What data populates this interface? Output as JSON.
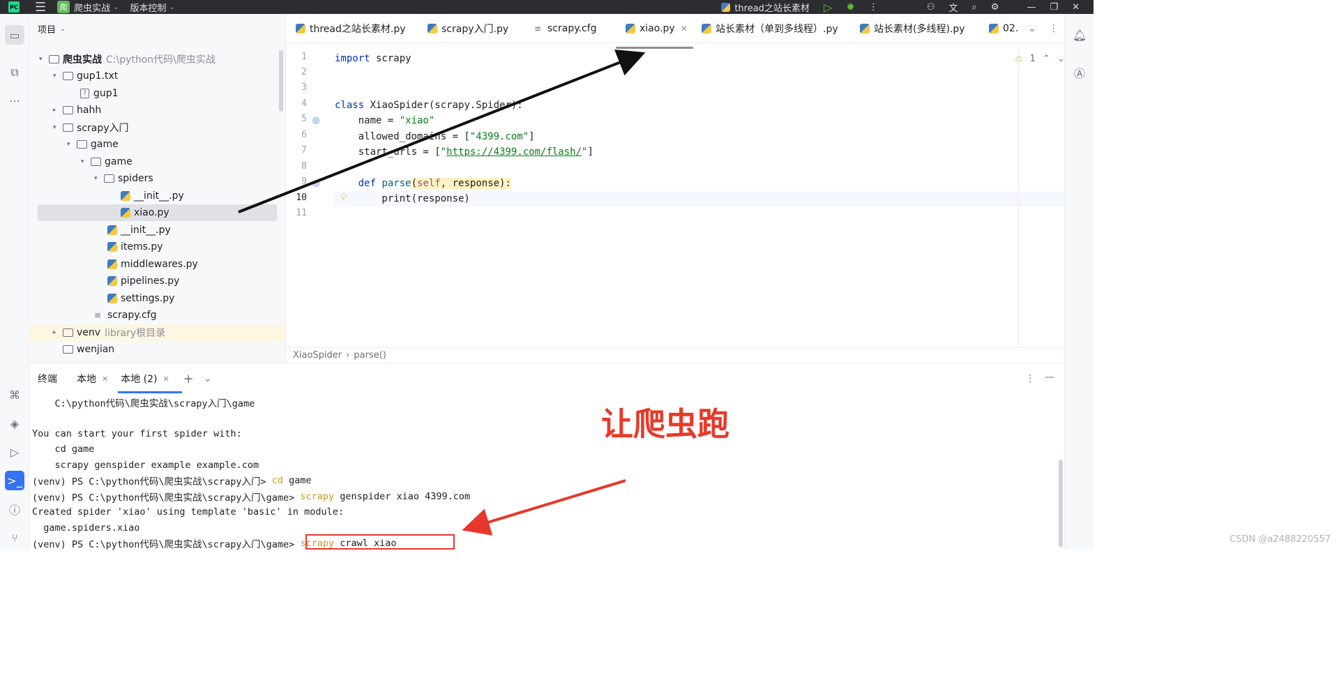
{
  "titlebar": {
    "project_badge": "爬",
    "project_name": "爬虫实战",
    "vcs": "版本控制",
    "run_config": "thread之站长素材"
  },
  "project_panel": {
    "title": "项目",
    "tree": [
      {
        "label": "爬虫实战",
        "extra": "C:\\python代码\\爬虫实战",
        "kind": "folder",
        "expanded": true
      },
      {
        "label": "gup1.txt",
        "kind": "folder",
        "expanded": true
      },
      {
        "label": "gup1",
        "kind": "txt"
      },
      {
        "label": "hahh",
        "kind": "folder",
        "expanded": false
      },
      {
        "label": "scrapy入门",
        "kind": "folder",
        "expanded": true
      },
      {
        "label": "game",
        "kind": "folder",
        "expanded": true
      },
      {
        "label": "game",
        "kind": "package",
        "expanded": true
      },
      {
        "label": "spiders",
        "kind": "package",
        "expanded": true
      },
      {
        "label": "__init__.py",
        "kind": "py"
      },
      {
        "label": "xiao.py",
        "kind": "py",
        "selected": true
      },
      {
        "label": "__init__.py",
        "kind": "py"
      },
      {
        "label": "items.py",
        "kind": "py"
      },
      {
        "label": "middlewares.py",
        "kind": "py"
      },
      {
        "label": "pipelines.py",
        "kind": "py"
      },
      {
        "label": "settings.py",
        "kind": "py"
      },
      {
        "label": "scrapy.cfg",
        "kind": "cfg"
      },
      {
        "label": "venv",
        "extra": "library根目录",
        "kind": "folder",
        "expanded": false
      },
      {
        "label": "wenjian",
        "kind": "folder"
      }
    ]
  },
  "editor": {
    "tabs": [
      {
        "label": "thread之站长素材.py"
      },
      {
        "label": "scrapy入门.py"
      },
      {
        "label": "scrapy.cfg"
      },
      {
        "label": "xiao.py",
        "active": true
      },
      {
        "label": "站长素材（单到多线程）.py"
      },
      {
        "label": "站长素材(多线程).py"
      },
      {
        "label": "02."
      }
    ],
    "warning_count": "1",
    "line_numbers": [
      "1",
      "2",
      "3",
      "4",
      "5",
      "6",
      "7",
      "8",
      "9",
      "10",
      "11"
    ],
    "code": {
      "l1_kw": "import",
      "l1_rest": " scrapy",
      "l4_kw": "class",
      "l4_rest": " XiaoSpider(scrapy.Spider):",
      "l5_a": "    name = ",
      "l5_str": "\"xiao\"",
      "l6_a": "    allowed_domains = [",
      "l6_str": "\"4399.com\"",
      "l6_b": "]",
      "l7_a": "    start_urls = [",
      "l7_q1": "\"",
      "l7_url": "https://4399.com/flash/",
      "l7_q2": "\"",
      "l7_b": "]",
      "l9_kw": "    def",
      "l9_fn": " parse",
      "l9_p1": "(",
      "l9_self": "self",
      "l9_p2": ", response):",
      "l10": "        print(response)"
    },
    "breadcrumb_class": "XiaoSpider",
    "breadcrumb_method": "parse()"
  },
  "terminal": {
    "title": "终端",
    "tabs": [
      {
        "label": "本地"
      },
      {
        "label": "本地 (2)",
        "active": true
      }
    ],
    "lines": [
      "    C:\\python代码\\爬虫实战\\scrapy入门\\game",
      "",
      "You can start your first spider with:",
      "    cd game",
      "    scrapy genspider example example.com"
    ],
    "cmd1_prefix": "(venv) PS C:\\python代码\\爬虫实战\\scrapy入门> ",
    "cmd1_kw": "cd",
    "cmd1_rest": " game",
    "cmd2_prefix": "(venv) PS C:\\python代码\\爬虫实战\\scrapy入门\\game> ",
    "cmd2_kw": "scrapy",
    "cmd2_rest": " genspider xiao 4399.com",
    "out1": "Created spider 'xiao' using template 'basic' in module:",
    "out2": "  game.spiders.xiao",
    "cmd3_prefix": "(venv) PS C:\\python代码\\爬虫实战\\scrapy入门\\game> ",
    "cmd3_kw": "scrapy",
    "cmd3_rest": " crawl xiao"
  },
  "annotation": "让爬虫跑",
  "watermark": "CSDN @a2488220557",
  "colors": {
    "accent": "#3574f0",
    "annotation": "#e83a2a"
  }
}
